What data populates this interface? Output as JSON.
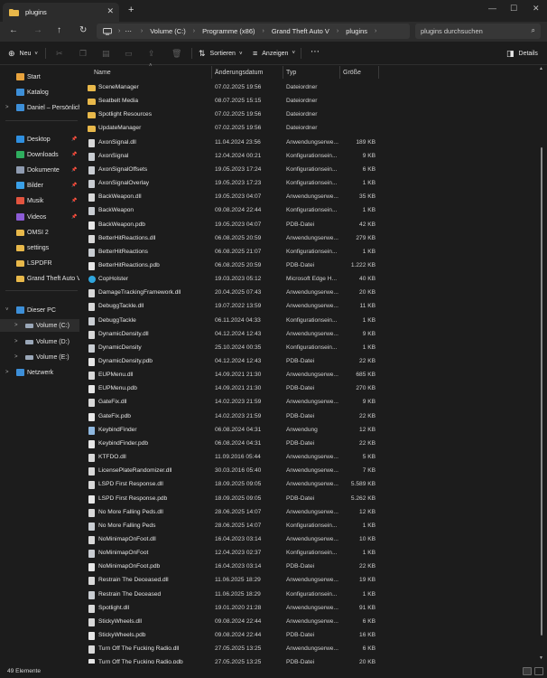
{
  "window": {
    "tab_title": "plugins",
    "tab_close": "✕",
    "new_tab": "+",
    "minimize": "—",
    "maximize": "☐",
    "close": "✕"
  },
  "nav": {
    "back": "←",
    "forward": "→",
    "up": "↑",
    "refresh": "↻",
    "monitor_icon": "monitor-icon",
    "overflow": "⋯",
    "breadcrumb": [
      "Volume (C:)",
      "Programme (x86)",
      "Grand Theft Auto V",
      "plugins"
    ],
    "crumb_sep": ">",
    "search_placeholder": "plugins durchsuchen"
  },
  "toolbar": {
    "new_label": "Neu",
    "new_caret": "˅",
    "sort_label": "Sortieren",
    "view_label": "Anzeigen",
    "more": "⋯",
    "details_label": "Details"
  },
  "sidebar": {
    "quick": [
      {
        "label": "Start",
        "icon": "home-icon",
        "color": "#e8a33d"
      },
      {
        "label": "Katalog",
        "icon": "gallery-icon",
        "color": "#3d8fd8"
      },
      {
        "label": "Daniel – Persönlich",
        "icon": "cloud-icon",
        "color": "#3d8fd8",
        "chevron": true
      }
    ],
    "pinned": [
      {
        "label": "Desktop",
        "icon": "desktop-icon",
        "color": "#2f8fe0",
        "pinned": true
      },
      {
        "label": "Downloads",
        "icon": "download-icon",
        "color": "#2fae5f",
        "pinned": true
      },
      {
        "label": "Dokumente",
        "icon": "documents-icon",
        "color": "#8f9bb0",
        "pinned": true
      },
      {
        "label": "Bilder",
        "icon": "pictures-icon",
        "color": "#3aa0e8",
        "pinned": true
      },
      {
        "label": "Musik",
        "icon": "music-icon",
        "color": "#e2543f",
        "pinned": true
      },
      {
        "label": "Videos",
        "icon": "videos-icon",
        "color": "#8c5cd6",
        "pinned": true
      },
      {
        "label": "OMSI 2",
        "icon": "folder-icon",
        "color": "#e8b84a"
      },
      {
        "label": "settings",
        "icon": "folder-icon",
        "color": "#e8b84a"
      },
      {
        "label": "LSPDFR",
        "icon": "folder-icon",
        "color": "#e8b84a"
      },
      {
        "label": "Grand Theft Auto V",
        "icon": "folder-icon",
        "color": "#e8b84a"
      }
    ],
    "pc": [
      {
        "label": "Dieser PC",
        "icon": "pc-icon",
        "color": "#3d8fd8",
        "chevron": "˅"
      },
      {
        "label": "Volume (C:)",
        "icon": "drive-icon",
        "color": "#9aa7b8",
        "chevron": ">",
        "selected": true
      },
      {
        "label": "Volume (D:)",
        "icon": "drive-icon",
        "color": "#9aa7b8",
        "chevron": ">"
      },
      {
        "label": "Volume (E:)",
        "icon": "drive-icon",
        "color": "#9aa7b8",
        "chevron": ">"
      },
      {
        "label": "Netzwerk",
        "icon": "network-icon",
        "color": "#3d8fd8",
        "chevron": ">"
      }
    ]
  },
  "columns": {
    "name": "Name",
    "date": "Änderungsdatum",
    "type": "Typ",
    "size": "Größe"
  },
  "files": [
    {
      "name": "SceneManager",
      "date": "07.02.2025 19:56",
      "type": "Dateiordner",
      "size": "",
      "icon": "folder-icon"
    },
    {
      "name": "Seatbelt Media",
      "date": "08.07.2025 15:15",
      "type": "Dateiordner",
      "size": "",
      "icon": "folder-icon"
    },
    {
      "name": "Spotlight Resources",
      "date": "07.02.2025 19:56",
      "type": "Dateiordner",
      "size": "",
      "icon": "folder-icon"
    },
    {
      "name": "UpdateManager",
      "date": "07.02.2025 19:56",
      "type": "Dateiordner",
      "size": "",
      "icon": "folder-icon"
    },
    {
      "name": "AxonSignal.dll",
      "date": "11.04.2024 23:56",
      "type": "Anwendungserwe...",
      "size": "189 KB",
      "icon": "dll-icon"
    },
    {
      "name": "AxonSignal",
      "date": "12.04.2024 00:21",
      "type": "Konfigurationsein...",
      "size": "9 KB",
      "icon": "ini-icon"
    },
    {
      "name": "AxonSignalOffsets",
      "date": "19.05.2023 17:24",
      "type": "Konfigurationsein...",
      "size": "6 KB",
      "icon": "ini-icon"
    },
    {
      "name": "AxonSignalOverlay",
      "date": "19.05.2023 17:23",
      "type": "Konfigurationsein...",
      "size": "1 KB",
      "icon": "ini-icon"
    },
    {
      "name": "BackWeapon.dll",
      "date": "19.05.2023 04:07",
      "type": "Anwendungserwe...",
      "size": "35 KB",
      "icon": "dll-icon"
    },
    {
      "name": "BackWeapon",
      "date": "09.08.2024 22:44",
      "type": "Konfigurationsein...",
      "size": "1 KB",
      "icon": "ini-icon"
    },
    {
      "name": "BackWeapon.pdb",
      "date": "19.05.2023 04:07",
      "type": "PDB-Datei",
      "size": "42 KB",
      "icon": "file-icon"
    },
    {
      "name": "BetterHitReactions.dll",
      "date": "06.08.2025 20:59",
      "type": "Anwendungserwe...",
      "size": "279 KB",
      "icon": "dll-icon"
    },
    {
      "name": "BetterHitReactions",
      "date": "06.08.2025 21:07",
      "type": "Konfigurationsein...",
      "size": "1 KB",
      "icon": "ini-icon"
    },
    {
      "name": "BetterHitReactions.pdb",
      "date": "06.08.2025 20:59",
      "type": "PDB-Datei",
      "size": "1.222 KB",
      "icon": "file-icon"
    },
    {
      "name": "CopHolster",
      "date": "19.03.2023 05:12",
      "type": "Microsoft Edge H...",
      "size": "40 KB",
      "icon": "edge-icon"
    },
    {
      "name": "DamageTrackingFramework.dll",
      "date": "20.04.2025 07:43",
      "type": "Anwendungserwe...",
      "size": "20 KB",
      "icon": "dll-icon"
    },
    {
      "name": "DebuggTackle.dll",
      "date": "19.07.2022 13:59",
      "type": "Anwendungserwe...",
      "size": "11 KB",
      "icon": "dll-icon"
    },
    {
      "name": "DebuggTackle",
      "date": "06.11.2024 04:33",
      "type": "Konfigurationsein...",
      "size": "1 KB",
      "icon": "ini-icon"
    },
    {
      "name": "DynamicDensity.dll",
      "date": "04.12.2024 12:43",
      "type": "Anwendungserwe...",
      "size": "9 KB",
      "icon": "dll-icon"
    },
    {
      "name": "DynamicDensity",
      "date": "25.10.2024 00:35",
      "type": "Konfigurationsein...",
      "size": "1 KB",
      "icon": "ini-icon"
    },
    {
      "name": "DynamicDensity.pdb",
      "date": "04.12.2024 12:43",
      "type": "PDB-Datei",
      "size": "22 KB",
      "icon": "file-icon"
    },
    {
      "name": "EUPMenu.dll",
      "date": "14.09.2021 21:30",
      "type": "Anwendungserwe...",
      "size": "685 KB",
      "icon": "dll-icon"
    },
    {
      "name": "EUPMenu.pdb",
      "date": "14.09.2021 21:30",
      "type": "PDB-Datei",
      "size": "270 KB",
      "icon": "file-icon"
    },
    {
      "name": "GateFix.dll",
      "date": "14.02.2023 21:59",
      "type": "Anwendungserwe...",
      "size": "9 KB",
      "icon": "dll-icon"
    },
    {
      "name": "GateFix.pdb",
      "date": "14.02.2023 21:59",
      "type": "PDB-Datei",
      "size": "22 KB",
      "icon": "file-icon"
    },
    {
      "name": "KeybindFinder",
      "date": "06.08.2024 04:31",
      "type": "Anwendung",
      "size": "12 KB",
      "icon": "exe-icon"
    },
    {
      "name": "KeybindFinder.pdb",
      "date": "06.08.2024 04:31",
      "type": "PDB-Datei",
      "size": "22 KB",
      "icon": "file-icon"
    },
    {
      "name": "KTFDO.dll",
      "date": "11.09.2016 05:44",
      "type": "Anwendungserwe...",
      "size": "5 KB",
      "icon": "dll-icon"
    },
    {
      "name": "LicensePlateRandomizer.dll",
      "date": "30.03.2016 05:40",
      "type": "Anwendungserwe...",
      "size": "7 KB",
      "icon": "dll-icon"
    },
    {
      "name": "LSPD First Response.dll",
      "date": "18.09.2025 09:05",
      "type": "Anwendungserwe...",
      "size": "5.589 KB",
      "icon": "dll-icon"
    },
    {
      "name": "LSPD First Response.pdb",
      "date": "18.09.2025 09:05",
      "type": "PDB-Datei",
      "size": "5.262 KB",
      "icon": "file-icon"
    },
    {
      "name": "No More Falling Peds.dll",
      "date": "28.06.2025 14:07",
      "type": "Anwendungserwe...",
      "size": "12 KB",
      "icon": "dll-icon"
    },
    {
      "name": "No More Falling Peds",
      "date": "28.06.2025 14:07",
      "type": "Konfigurationsein...",
      "size": "1 KB",
      "icon": "ini-icon"
    },
    {
      "name": "NoMinimapOnFoot.dll",
      "date": "16.04.2023 03:14",
      "type": "Anwendungserwe...",
      "size": "10 KB",
      "icon": "dll-icon"
    },
    {
      "name": "NoMinimapOnFoot",
      "date": "12.04.2023 02:37",
      "type": "Konfigurationsein...",
      "size": "1 KB",
      "icon": "ini-icon"
    },
    {
      "name": "NoMinimapOnFoot.pdb",
      "date": "16.04.2023 03:14",
      "type": "PDB-Datei",
      "size": "22 KB",
      "icon": "file-icon"
    },
    {
      "name": "Restrain The Deceased.dll",
      "date": "11.06.2025 18:29",
      "type": "Anwendungserwe...",
      "size": "19 KB",
      "icon": "dll-icon"
    },
    {
      "name": "Restrain The Deceased",
      "date": "11.06.2025 18:29",
      "type": "Konfigurationsein...",
      "size": "1 KB",
      "icon": "ini-icon"
    },
    {
      "name": "Spotlight.dll",
      "date": "19.01.2020 21:28",
      "type": "Anwendungserwe...",
      "size": "91 KB",
      "icon": "dll-icon"
    },
    {
      "name": "StickyWheels.dll",
      "date": "09.08.2024 22:44",
      "type": "Anwendungserwe...",
      "size": "6 KB",
      "icon": "dll-icon"
    },
    {
      "name": "StickyWheels.pdb",
      "date": "09.08.2024 22:44",
      "type": "PDB-Datei",
      "size": "16 KB",
      "icon": "file-icon"
    },
    {
      "name": "Turn Off The Fucking Radio.dll",
      "date": "27.05.2025 13:25",
      "type": "Anwendungserwe...",
      "size": "6 KB",
      "icon": "dll-icon"
    },
    {
      "name": "Turn Off The Fucking Radio.pdb",
      "date": "27.05.2025 13:25",
      "type": "PDB-Datei",
      "size": "20 KB",
      "icon": "file-icon"
    }
  ],
  "status": {
    "item_count": "49 Elemente"
  },
  "colors": {
    "folder": "#e8b84a",
    "accent": "#3d8fd8",
    "selected_bg": "#2d2d2d"
  }
}
